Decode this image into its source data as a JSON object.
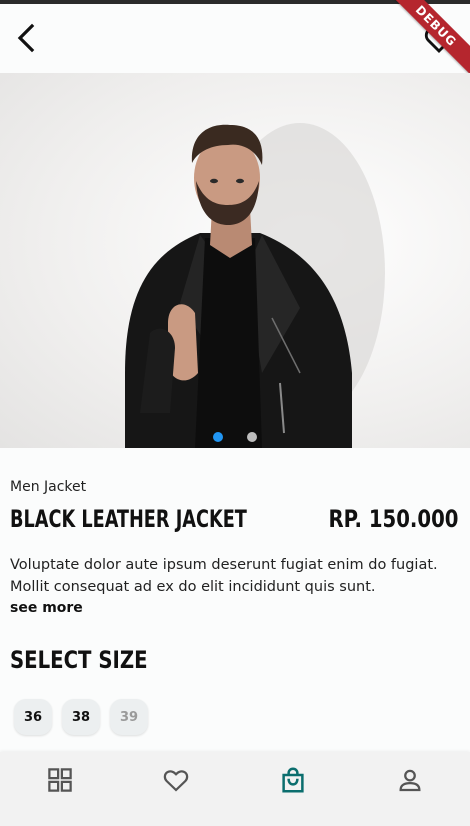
{
  "app": {
    "debug_banner": "DEBUG",
    "accent_color": "#0b6e6e",
    "dot_active_color": "#2196f3",
    "dot_inactive_color": "#bdbdbd"
  },
  "header": {
    "back_icon": "chevron-left-icon",
    "favorite_icon": "heart-outline-icon"
  },
  "gallery": {
    "image_description": "Man wearing a black leather jacket over a black t-shirt",
    "page_count": 2,
    "active_page": 1
  },
  "product": {
    "category": "Men Jacket",
    "name": "BLACK LEATHER JACKET",
    "price": "RP. 150.000",
    "description": "Voluptate dolor aute ipsum deserunt fugiat enim do fugiat. Mollit consequat ad ex do elit incididunt quis sunt.",
    "see_more": "see more"
  },
  "sizes": {
    "heading": "SELECT SIZE",
    "options": [
      {
        "label": "36",
        "available": true
      },
      {
        "label": "38",
        "available": true
      },
      {
        "label": "39",
        "available": false
      }
    ]
  },
  "bottom_nav": {
    "items": [
      {
        "icon": "grid-icon",
        "active": false
      },
      {
        "icon": "heart-icon",
        "active": false
      },
      {
        "icon": "shopping-bag-icon",
        "active": true
      },
      {
        "icon": "user-icon",
        "active": false
      }
    ]
  }
}
